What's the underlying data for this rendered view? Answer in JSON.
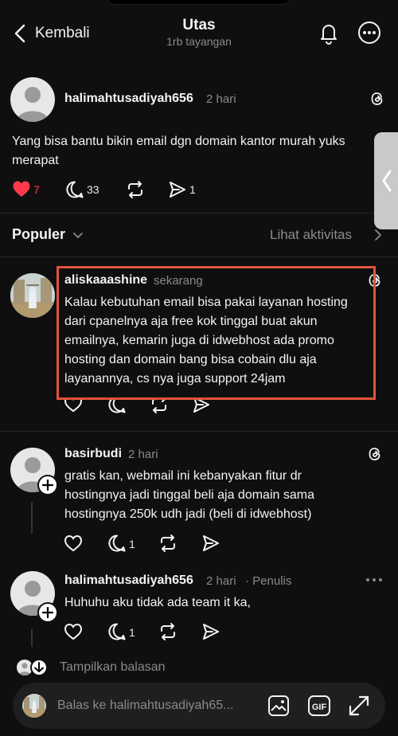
{
  "header": {
    "back_label": "Kembali",
    "title": "Utas",
    "subtitle": "1rb tayangan"
  },
  "main_post": {
    "username": "halimahtusadiyah656",
    "time": "2 hari",
    "text_lines": [
      "Yang bisa bantu bikin email dgn domain kantor murah yuks",
      "merapat"
    ],
    "likes": "7",
    "comments": "33",
    "shares": "1"
  },
  "sort": {
    "label": "Populer",
    "activity_label": "Lihat aktivitas"
  },
  "replies": [
    {
      "username": "aliskaaashine",
      "time": "sekarang",
      "text_lines": [
        "Kalau kebutuhan email bisa pakai layanan hosting",
        "dari cpanelnya aja free kok tinggal buat akun",
        "emailnya, kemarin juga di idwebhost ada promo",
        "hosting dan domain bang bisa cobain dlu aja",
        "layanannya, cs nya juga support 24jam"
      ]
    },
    {
      "username": "basirbudi",
      "time": "2 hari",
      "text_lines": [
        "gratis kan, webmail ini kebanyakan fitur dr",
        "hostingnya jadi tinggal beli aja domain sama",
        "hostingnya 250k udh jadi (beli di idwebhost)"
      ],
      "comments": "1"
    },
    {
      "username": "halimahtusadiyah656",
      "time": "2 hari",
      "tag": "· Penulis",
      "text_lines": [
        "Huhuhu aku tidak ada team it ka,"
      ],
      "comments": "1"
    }
  ],
  "show_replies_label": "Tampilkan balasan",
  "composer": {
    "placeholder": "Balas ke halimahtusadiyah65..."
  },
  "colors": {
    "background": "#0f0f0f",
    "like_red": "#ff3a4a",
    "highlight_border": "#e0533d"
  },
  "icons": [
    "back-chevron",
    "bell",
    "more-circle",
    "threads-logo",
    "heart",
    "comment",
    "repost",
    "share",
    "plus",
    "image",
    "gif",
    "expand"
  ]
}
